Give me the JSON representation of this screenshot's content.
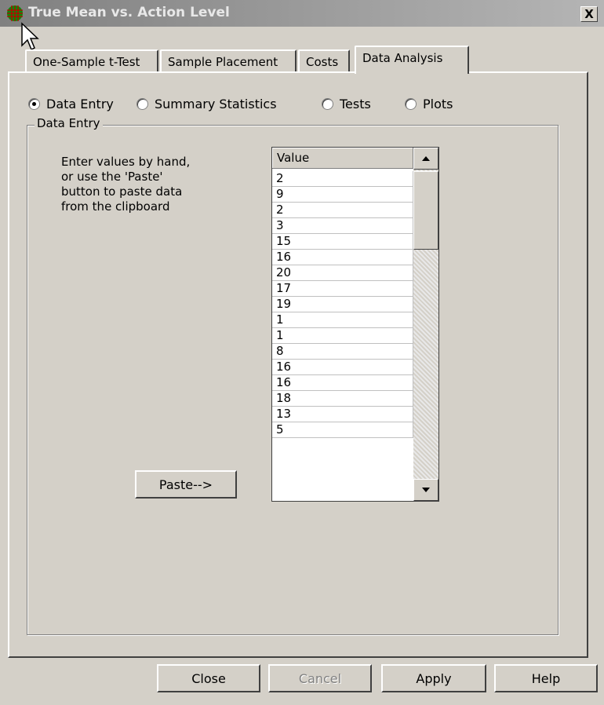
{
  "window": {
    "title": "True Mean vs. Action Level",
    "close_symbol": "X"
  },
  "tabs": [
    {
      "label": "One-Sample t-Test",
      "active": false
    },
    {
      "label": "Sample Placement",
      "active": false
    },
    {
      "label": "Costs",
      "active": false
    },
    {
      "label": "Data Analysis",
      "active": true
    }
  ],
  "modes": [
    {
      "label": "Data Entry",
      "checked": true
    },
    {
      "label": "Summary Statistics",
      "checked": false
    },
    {
      "label": "Tests",
      "checked": false
    },
    {
      "label": "Plots",
      "checked": false
    }
  ],
  "group": {
    "title": "Data Entry",
    "instructions": [
      "Enter values by hand,",
      "or use the 'Paste'",
      "button to paste data",
      "from the clipboard"
    ],
    "paste_label": "Paste-->"
  },
  "grid": {
    "header": "Value",
    "values": [
      "2",
      "9",
      "2",
      "3",
      "15",
      "16",
      "20",
      "17",
      "19",
      "1",
      "1",
      "8",
      "16",
      "16",
      "18",
      "13",
      "5"
    ]
  },
  "buttons": {
    "close": "Close",
    "cancel": "Cancel",
    "apply": "Apply",
    "help": "Help"
  },
  "colors": {
    "face": "#d4d0c8",
    "title_gradient_start": "#808080",
    "title_text": "#e8e8e8"
  },
  "icons": {
    "app": "grid-globe-icon",
    "cursor": "mouse-pointer-icon",
    "scroll_up": "arrow-up-icon",
    "scroll_down": "arrow-down-icon"
  }
}
